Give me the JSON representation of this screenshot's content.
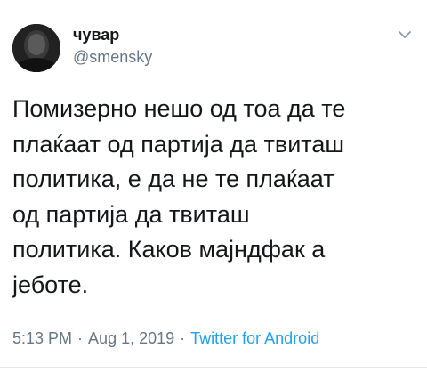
{
  "user": {
    "display_name": "чувар",
    "handle": "@smensky",
    "avatar_icon": "profile-photo"
  },
  "tweet": {
    "lines": [
      "Помизерно нешо од тоа да те",
      "плаќаат од партија да твиташ",
      "политика, е да не те плаќаат",
      "од партија да твиташ",
      "политика. Каков мајндфак а",
      "јеботе."
    ]
  },
  "meta": {
    "time": "5:13 PM",
    "separator": "·",
    "date": "Aug 1, 2019",
    "source": "Twitter for Android"
  },
  "menu": {
    "icon": "chevron-down-icon"
  },
  "colors": {
    "text": "#14171a",
    "secondary": "#657786",
    "link": "#1da1f2",
    "divider": "#e1e8ed"
  }
}
